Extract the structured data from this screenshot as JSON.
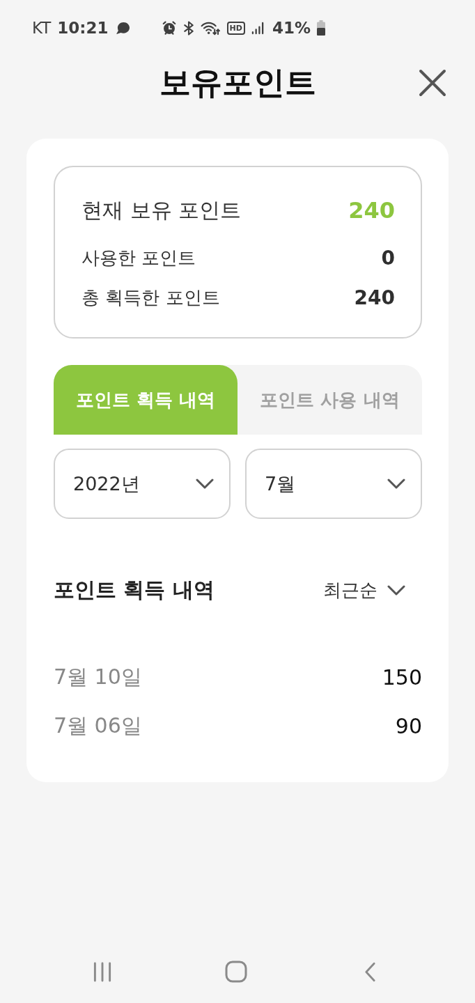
{
  "status_bar": {
    "carrier": "KT",
    "time": "10:21",
    "network_badge": "HD",
    "battery": "41%"
  },
  "header": {
    "title": "보유포인트"
  },
  "summary": [
    {
      "kind": "total",
      "label": "현재 보유 포인트",
      "value": "240"
    },
    {
      "kind": "detail",
      "label": "사용한 포인트",
      "value": "0"
    },
    {
      "kind": "detail",
      "label": "총 획득한 포인트",
      "value": "240"
    }
  ],
  "tabs": [
    {
      "label": "포인트 획득 내역",
      "selected": true
    },
    {
      "label": "포인트 사용 내역",
      "selected": false
    }
  ],
  "filters": [
    {
      "value": "2022년"
    },
    {
      "value": "7월"
    }
  ],
  "history": {
    "title": "포인트 획득 내역",
    "sort": "최근순",
    "entries": [
      {
        "date": "7월 10일",
        "points": "150"
      },
      {
        "date": "7월 06일",
        "points": "90"
      }
    ]
  }
}
